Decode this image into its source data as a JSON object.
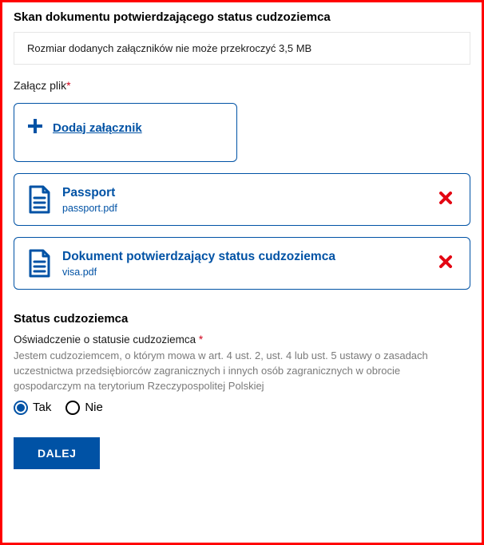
{
  "section": {
    "title": "Skan dokumentu potwierdzającego status cudzoziemca",
    "info_note": "Rozmiar dodanych załączników nie może przekroczyć 3,5 MB",
    "attach_label": "Załącz plik",
    "add_attachment_label": "Dodaj załącznik"
  },
  "files": [
    {
      "title": "Passport",
      "name": "passport.pdf"
    },
    {
      "title": "Dokument potwierdzający status cudzoziemca",
      "name": "visa.pdf"
    }
  ],
  "status": {
    "heading": "Status cudzoziemca",
    "sub_label": "Oświadczenie o statusie cudzoziemca",
    "legal_text": "Jestem cudzoziemcem, o którym mowa w art. 4 ust. 2, ust. 4 lub ust. 5 ustawy o zasadach uczestnictwa przedsiębiorców zagranicznych i innych osób zagranicznych w obrocie gospodarczym na terytorium Rzeczypospolitej Polskiej",
    "options": {
      "yes": "Tak",
      "no": "Nie"
    },
    "selected": "yes"
  },
  "actions": {
    "next": "DALEJ"
  }
}
